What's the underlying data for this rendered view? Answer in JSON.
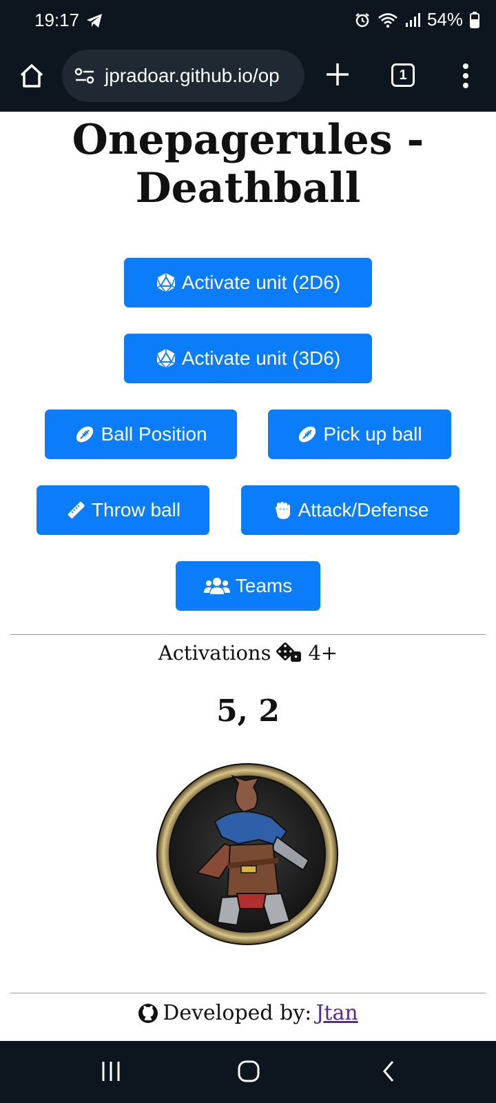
{
  "status_bar": {
    "time": "19:17",
    "battery": "54%",
    "icons": [
      "telegram-icon",
      "alarm-icon",
      "wifi-icon",
      "signal-icon",
      "battery-icon"
    ]
  },
  "browser": {
    "url": "jpradoar.github.io/op",
    "tab_count": "1",
    "icons": [
      "home-icon",
      "site-settings-icon",
      "new-tab-icon",
      "tab-switcher-icon",
      "more-menu-icon"
    ]
  },
  "page": {
    "title": "Onepagerules - Deathball",
    "buttons": {
      "activate_2d6": "Activate unit (2D6)",
      "activate_3d6": "Activate unit (3D6)",
      "ball_position": "Ball Position",
      "pick_up_ball": "Pick up ball",
      "throw_ball": "Throw ball",
      "attack_defense": "Attack/Defense",
      "teams": "Teams"
    },
    "activations_label": "Activations",
    "activations_threshold": "4+",
    "result": "5, 2",
    "footer": {
      "developed_by": "Developed by:",
      "author": "Jtan"
    }
  },
  "colors": {
    "primary_button": "#0b7dfb",
    "system_bar": "#0d151e",
    "link": "#5a2b8c"
  }
}
